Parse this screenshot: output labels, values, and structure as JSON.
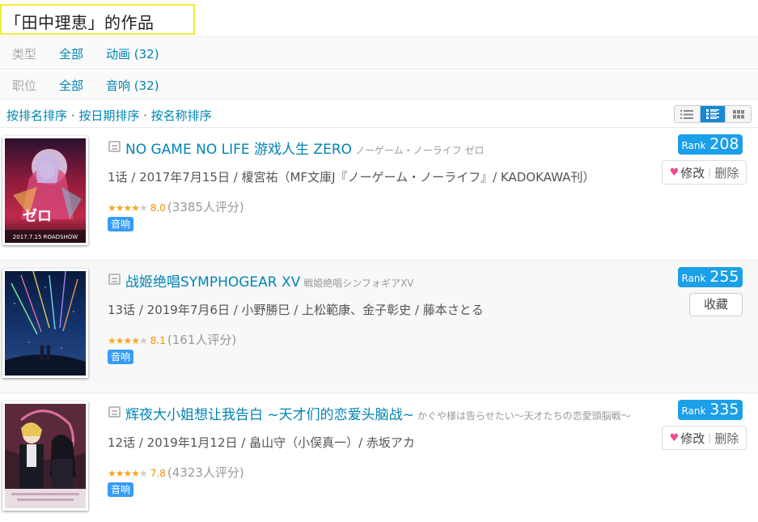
{
  "page_title": "「田中理恵」的作品",
  "filters": [
    {
      "label": "类型",
      "all": "全部",
      "option": "动画 (32)"
    },
    {
      "label": "职位",
      "all": "全部",
      "option": "音响 (32)"
    }
  ],
  "sort": {
    "by_rank": "按排名排序",
    "by_date": "按日期排序",
    "by_name": "按名称排序",
    "separator": " · "
  },
  "view_icons": [
    "list-compact-icon",
    "list-detail-icon",
    "grid-icon"
  ],
  "items": [
    {
      "title": "NO GAME NO LIFE 游戏人生 ZERO",
      "original_title": "ノーゲーム・ノーライフ ゼロ",
      "info": "1话 / 2017年7月15日 / 榎宮祐（MF文庫J『ノーゲーム・ノーライフ』/ KADOKAWA刊）",
      "score": "8.0",
      "votes": "(3385人评分)",
      "stars": 4,
      "tag": "音响",
      "rank_label": "Rank",
      "rank_value": "208",
      "action": "edit",
      "edit_label": "修改",
      "delete_label": "删除",
      "cover_text": "2017.7.15 ROADSHOW"
    },
    {
      "title": "战姬绝唱SYMPHOGEAR XV",
      "original_title": "戦姫絶唱シンフォギアXV",
      "info": "13话 / 2019年7月6日 / 小野勝巳 / 上松範康、金子彰史 / 藤本さとる",
      "score": "8.1",
      "votes": "(161人评分)",
      "stars": 4,
      "tag": "音响",
      "rank_label": "Rank",
      "rank_value": "255",
      "action": "collect",
      "collect_label": "收藏"
    },
    {
      "title": "辉夜大小姐想让我告白 ~天才们的恋爱头脑战~",
      "original_title": "かぐや様は告らせたい～天才たちの恋愛頭脳戦～",
      "info": "12话 / 2019年1月12日 / 畠山守（小俣真一）/ 赤坂アカ",
      "score": "7.8",
      "votes": "(4323人评分)",
      "stars": 4,
      "tag": "音响",
      "rank_label": "Rank",
      "rank_value": "335",
      "action": "edit",
      "edit_label": "修改",
      "delete_label": "删除"
    }
  ],
  "colors": {
    "link": "#0084b4",
    "rank_badge": "#1b9fe8",
    "tag": "#369cf8",
    "star": "#f5a623",
    "heart": "#ee4c8f",
    "title_highlight": "#f0ec3c"
  }
}
